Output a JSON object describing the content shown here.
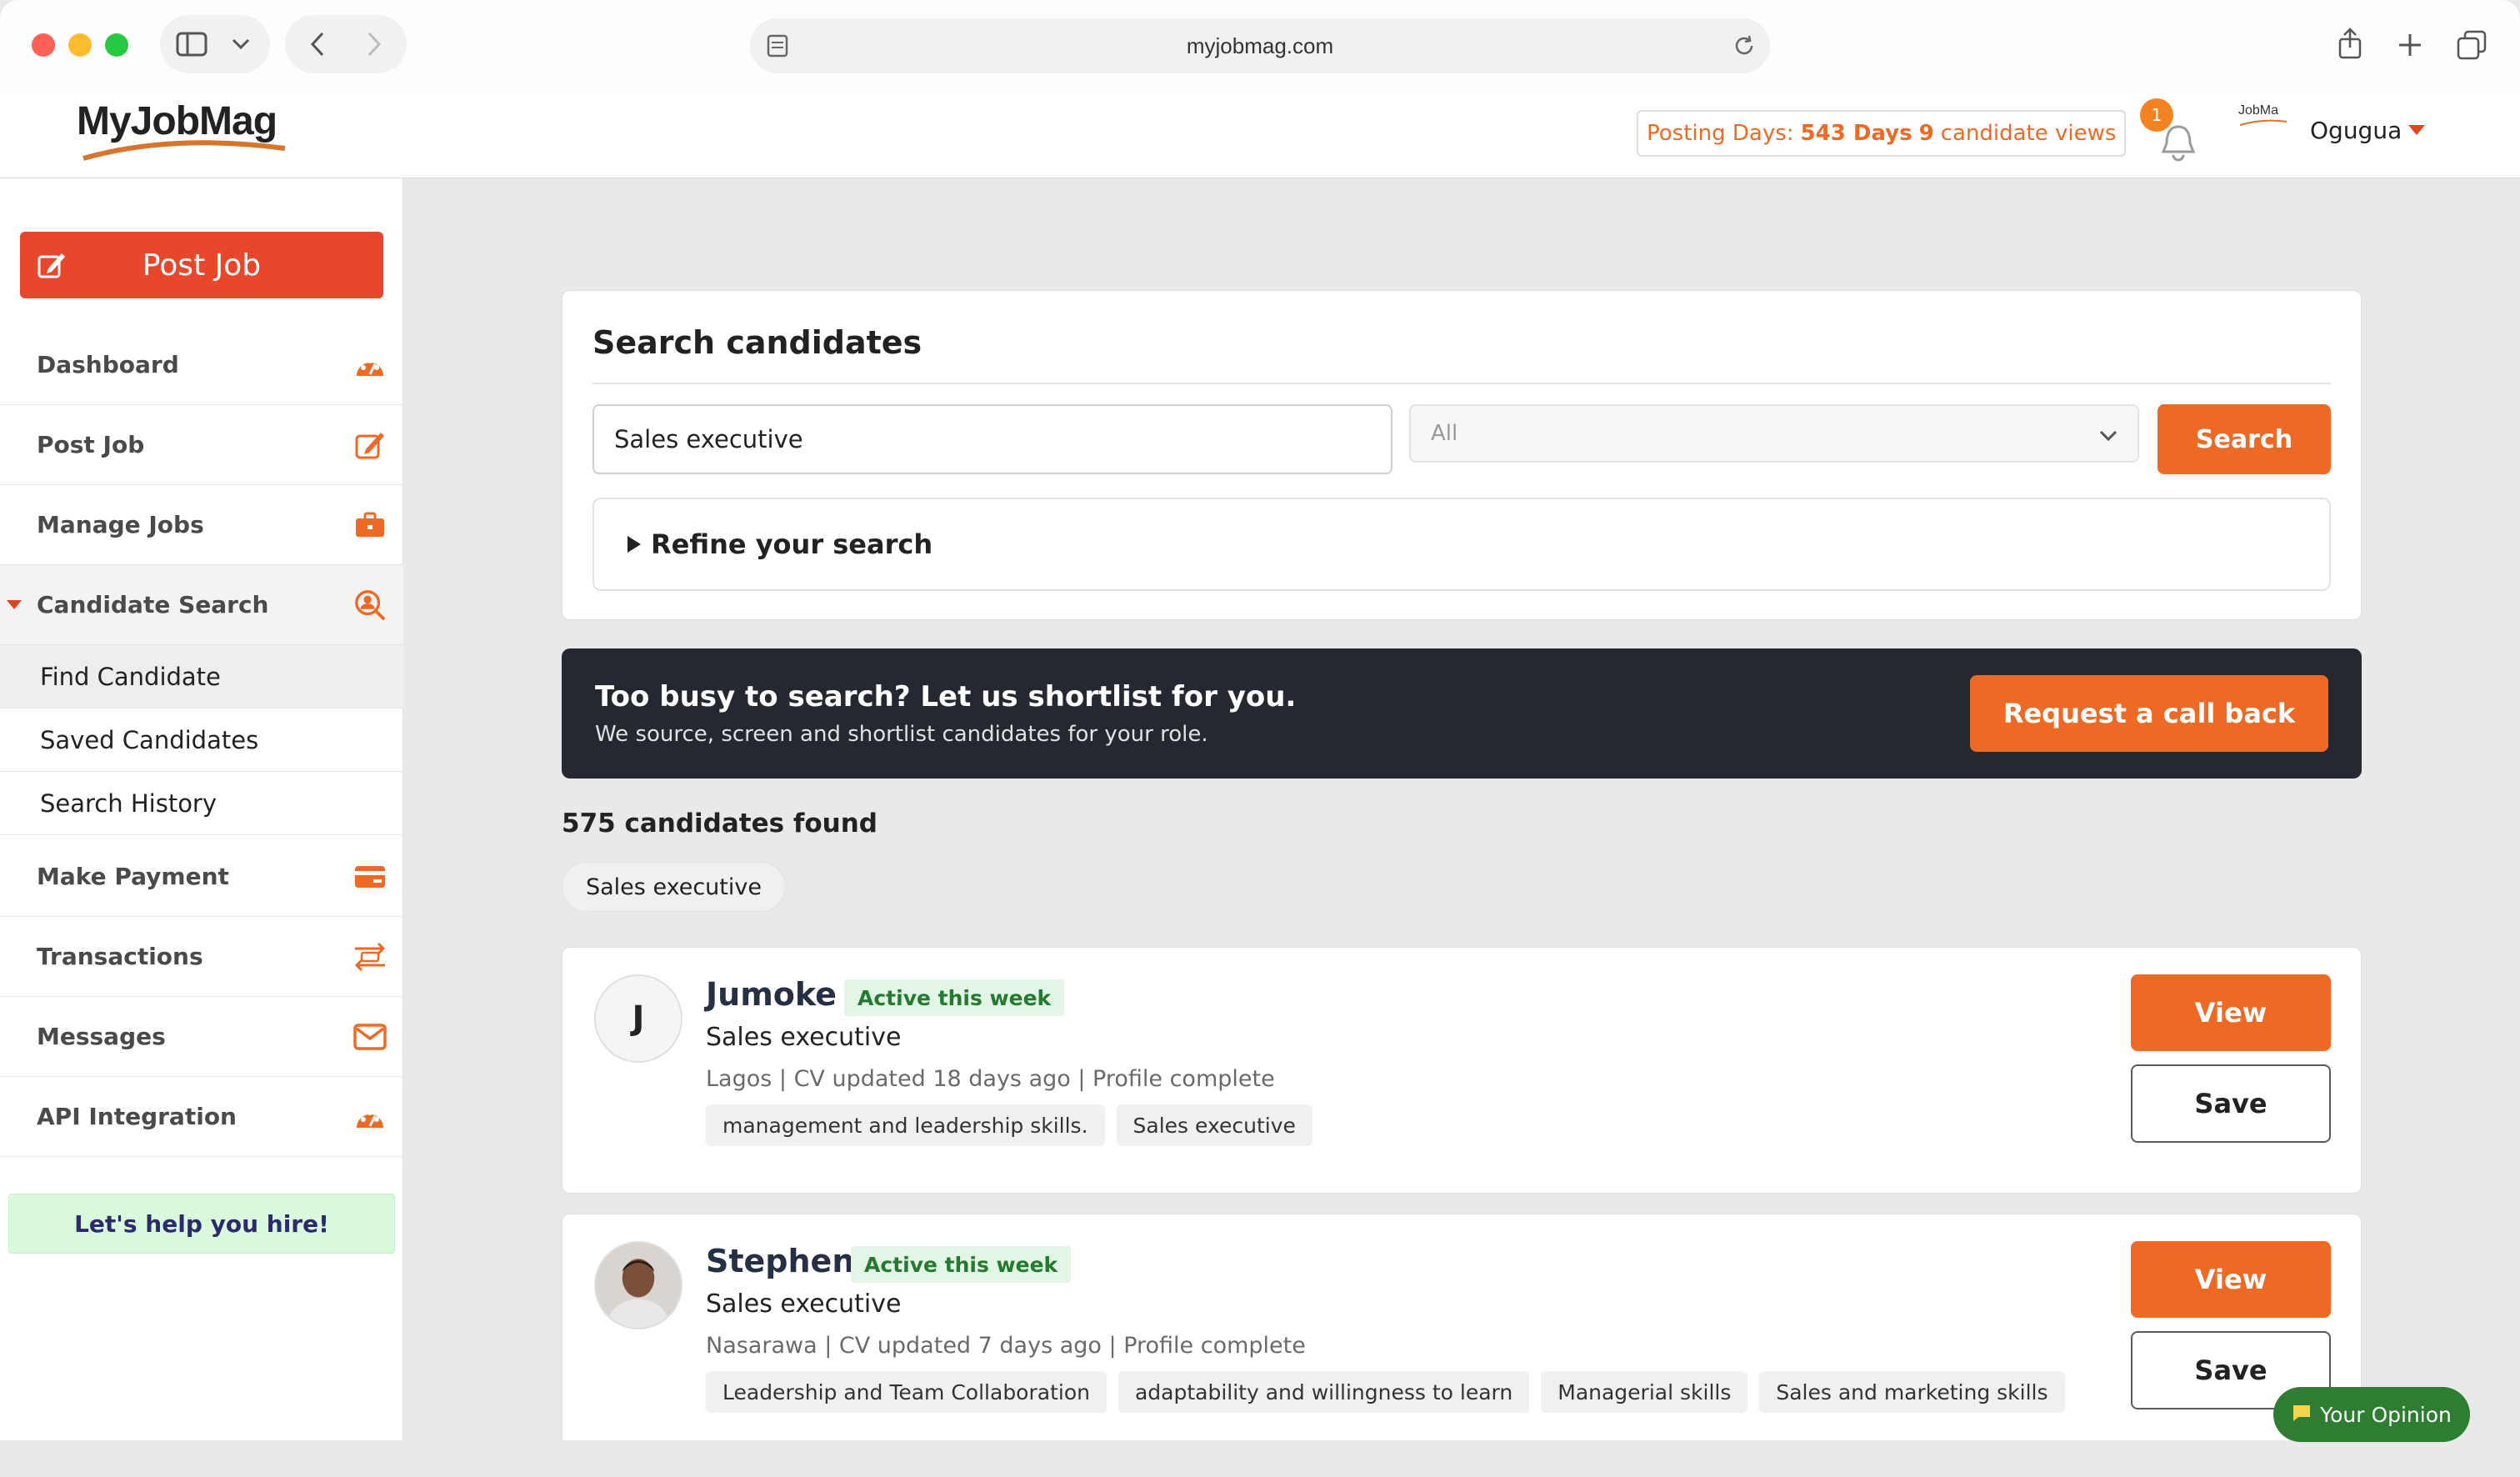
{
  "browser": {
    "url": "myjobmag.com"
  },
  "header": {
    "logo_text": "MyJobMag",
    "posting_days_label": "Posting Days:",
    "posting_days_value": "543 Days",
    "candidate_views_count": "9",
    "candidate_views_label": "candidate views",
    "notification_count": "1",
    "mini_logo_text": "JobMa",
    "user_name": "Ogugua"
  },
  "sidebar": {
    "post_job_button": "Post Job",
    "items": [
      {
        "label": "Dashboard"
      },
      {
        "label": "Post Job"
      },
      {
        "label": "Manage Jobs"
      },
      {
        "label": "Candidate Search"
      },
      {
        "label": "Make Payment"
      },
      {
        "label": "Transactions"
      },
      {
        "label": "Messages"
      },
      {
        "label": "API Integration"
      }
    ],
    "sub_items": [
      {
        "label": "Find Candidate"
      },
      {
        "label": "Saved Candidates"
      },
      {
        "label": "Search History"
      }
    ],
    "help_text": "Let's help you hire!"
  },
  "search": {
    "title": "Search candidates",
    "query": "Sales executive",
    "category_selected": "All",
    "button_label": "Search",
    "refine_label": "Refine your search"
  },
  "banner": {
    "title": "Too busy to search? Let us shortlist for you.",
    "subtitle": "We source, screen and shortlist candidates for your role.",
    "button_label": "Request a call back"
  },
  "results": {
    "count_text": "575 candidates found",
    "filter_chip": "Sales executive",
    "candidates": [
      {
        "initial": "J",
        "name": "Jumoke",
        "badge": "Active this week",
        "role": "Sales executive",
        "meta": "Lagos | CV updated 18 days ago | Profile complete",
        "skills": [
          "management and leadership skills.",
          "Sales executive"
        ],
        "view_label": "View",
        "save_label": "Save"
      },
      {
        "initial": "",
        "name": "Stephen",
        "badge": "Active this week",
        "role": "Sales executive",
        "meta": "Nasarawa | CV updated 7 days ago | Profile complete",
        "skills": [
          "Leadership and Team Collaboration",
          "adaptability and willingness to learn",
          "Managerial skills",
          "Sales and marketing skills"
        ],
        "view_label": "View",
        "save_label": "Save"
      }
    ]
  },
  "feedback": {
    "label": "Your Opinion"
  },
  "colors": {
    "accent_orange": "#ee6a24",
    "post_job_red": "#e9472c",
    "banner_dark": "#252830",
    "active_green": "#257a31",
    "help_bg": "#d9fadc"
  }
}
